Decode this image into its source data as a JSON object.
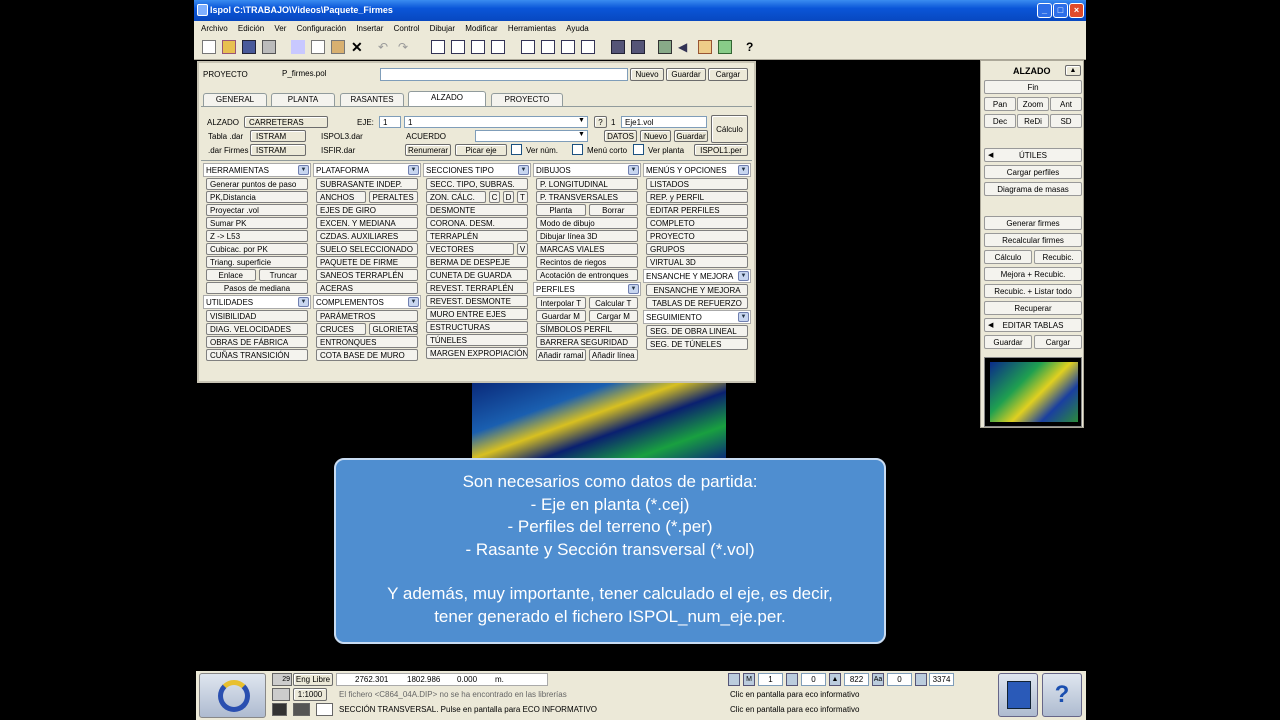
{
  "window": {
    "title": "Ispol  C:\\TRABAJO\\Videos\\Paquete_Firmes"
  },
  "menu": [
    "Archivo",
    "Edición",
    "Ver",
    "Configuración",
    "Insertar",
    "Control",
    "Dibujar",
    "Modificar",
    "Herramientas",
    "Ayuda"
  ],
  "project": {
    "label": "PROYECTO",
    "file": "P_firmes.pol",
    "new": "Nuevo",
    "save": "Guardar",
    "load": "Cargar"
  },
  "tabs": [
    "GENERAL",
    "PLANTA",
    "RASANTES",
    "ALZADO",
    "PROYECTO"
  ],
  "alzado": {
    "label": "ALZADO",
    "type": "CARRETERAS",
    "eje_label": "EJE:",
    "eje_num": "1",
    "eje_sel": "1",
    "help": "?",
    "vol_num": "1",
    "vol_file": "Eje1.vol",
    "calc": "Cálculo",
    "tabla_label": "Tabla .dar",
    "tabla_val": "ISTRAM",
    "tabla_file": "ISPOL3.dar",
    "acuerdo": "ACUERDO",
    "datos": "DATOS",
    "nuevo": "Nuevo",
    "guardar": "Guardar",
    "firmes_label": ".dar Firmes",
    "firmes_val": "ISTRAM",
    "firmes_file": "ISFIR.dar",
    "renumerar": "Renumerar",
    "picar": "Picar eje",
    "ver_num": "Ver núm.",
    "menu_corto": "Menú corto",
    "ver_planta": "Ver planta",
    "per_file": "ISPOL1.per"
  },
  "columns": {
    "herramientas": {
      "title": "HERRAMIENTAS",
      "items": [
        "Generar puntos de paso",
        "PK,Distancia",
        "Proyectar .vol",
        "Sumar PK",
        "Z -> L53",
        "Cubicac. por PK",
        "Triang. superficie"
      ],
      "row1": [
        "Enlace",
        "Truncar"
      ],
      "last": "Pasos de mediana",
      "utilidades": {
        "title": "UTILIDADES",
        "items": [
          "VISIBILIDAD",
          "DIAG. VELOCIDADES",
          "OBRAS DE FÁBRICA",
          "CUÑAS TRANSICIÓN"
        ]
      }
    },
    "plataforma": {
      "title": "PLATAFORMA",
      "items": [
        "SUBRASANTE INDEP."
      ],
      "row": [
        "ANCHOS",
        "PERALTES"
      ],
      "items2": [
        "EJES DE GIRO",
        "EXCEN. Y MEDIANA",
        "CZDAS. AUXILIARES",
        "SUELO SELECCIONADO",
        "PAQUETE DE FIRME",
        "SANEOS TERRAPLÉN",
        "ACERAS"
      ],
      "complementos": {
        "title": "COMPLEMENTOS",
        "items": [
          "PARÁMETROS"
        ],
        "row": [
          "CRUCES",
          "GLORIETAS"
        ],
        "items2": [
          "ENTRONQUES",
          "COTA BASE DE MURO"
        ]
      }
    },
    "secciones": {
      "title": "SECCIONES TIPO",
      "items": [
        "SECC. TIPO, SUBRAS."
      ],
      "zon": "ZON. CÁLC.",
      "zon_btns": [
        "C",
        "D",
        "T"
      ],
      "items2": [
        "DESMONTE",
        "CORONA. DESM.",
        "TERRAPLÉN"
      ],
      "vectores": "VECTORES",
      "vectores_btn": "V",
      "items3": [
        "BERMA DE DESPEJE",
        "CUNETA DE GUARDA",
        "REVEST. TERRAPLÉN",
        "REVEST. DESMONTE",
        "MURO ENTRE EJES",
        "ESTRUCTURAS",
        "TÚNELES",
        "MARGEN EXPROPIACIÓN"
      ]
    },
    "dibujos": {
      "title": "DIBUJOS",
      "items": [
        "P. LONGITUDINAL",
        "P. TRANSVERSALES"
      ],
      "row": [
        "Planta",
        "Borrar"
      ],
      "items2": [
        "Modo de dibujo",
        "Dibujar línea 3D",
        "MARCAS VIALES",
        "Recintos de riegos",
        "Acotación de entronques"
      ],
      "perfiles": {
        "title": "PERFILES",
        "row1": [
          "Interpolar T",
          "Calcular T"
        ],
        "row2": [
          "Guardar M",
          "Cargar M"
        ],
        "items": [
          "SÍMBOLOS PERFIL",
          "BARRERA SEGURIDAD"
        ],
        "row3": [
          "Añadir ramal",
          "Añadir línea"
        ]
      }
    },
    "menus": {
      "title": "MENÚS Y OPCIONES",
      "items": [
        "LISTADOS",
        "REP. y PERFIL",
        "EDITAR PERFILES",
        "COMPLETO",
        "PROYECTO",
        "GRUPOS",
        "VIRTUAL 3D"
      ],
      "ensanche": {
        "title": "ENSANCHE Y MEJORA",
        "items": [
          "ENSANCHE Y MEJORA",
          "TABLAS DE REFUERZO"
        ]
      },
      "seguimiento": {
        "title": "SEGUIMIENTO",
        "items": [
          "SEG. DE OBRA LINEAL",
          "SEG. DE TÚNELES"
        ]
      }
    }
  },
  "right": {
    "title": "ALZADO",
    "fin": "Fin",
    "nav": [
      "Pan",
      "Zoom",
      "Ant",
      "Dec",
      "ReDi",
      "SD"
    ],
    "utiles": "ÚTILES",
    "cargar_perfiles": "Cargar perfiles",
    "diagrama": "Diagrama de masas",
    "generar": "Generar firmes",
    "recalcular": "Recalcular firmes",
    "calculo": "Cálculo",
    "recubic": "Recubic.",
    "mejora": "Mejora + Recubic.",
    "recubic_listar": "Recubic. + Listar todo",
    "recuperar": "Recuperar",
    "editar": "EDITAR TABLAS",
    "guardar": "Guardar",
    "cargar": "Cargar"
  },
  "statusbar": {
    "layer": "29",
    "mode": "Eng Libre",
    "x": "2762.301",
    "y": "1802.986",
    "z": "0.000",
    "unit": "m.",
    "scale": "1:1000",
    "msg1": "El fichero <C864_04A.DIP> no se ha encontrado en las librerías",
    "msg2": "SECCIÓN TRANSVERSAL. Pulse en pantalla para ECO INFORMATIVO",
    "eco1": "Clic en pantalla para eco informativo",
    "eco2": "Clic en pantalla para eco informativo",
    "n1": "1",
    "n2": "0",
    "n3": "822",
    "n4": "0",
    "n5": "3374"
  },
  "overlay": {
    "lines": [
      "Son necesarios como datos de partida:",
      "- Eje en planta (*.cej)",
      "- Perfiles del terreno (*.per)",
      "- Rasante y Sección transversal (*.vol)",
      "",
      "Y además, muy importante, tener calculado el eje, es decir,",
      "tener generado el fichero ISPOL_num_eje.per."
    ]
  },
  "colors": {
    "title": "#0a55d8",
    "panel": "#ece9d8",
    "overlay": "#4f8ed0"
  }
}
